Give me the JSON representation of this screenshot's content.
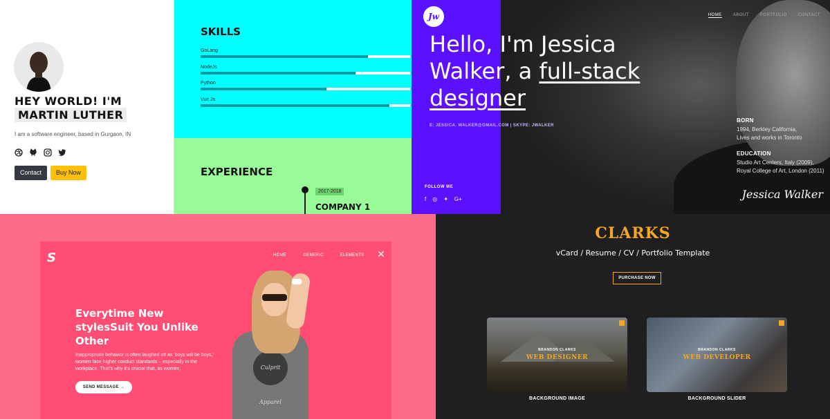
{
  "panel1": {
    "greeting": "HEY WORLD! I'M",
    "name": "MARTIN LUTHER",
    "bio": "I am a software engineer, based in Gurgaon, IN",
    "socials": [
      "dribbble-icon",
      "github-icon",
      "instagram-icon",
      "twitter-icon"
    ],
    "contact_label": "Contact",
    "buy_label": "Buy Now"
  },
  "panel2": {
    "skills_title": "SKILLS",
    "skills": [
      {
        "name": "GoLang",
        "level": 0.8
      },
      {
        "name": "NodeJs",
        "level": 0.74
      },
      {
        "name": "Python",
        "level": 0.6
      },
      {
        "name": "Vue Js",
        "level": 0.9
      }
    ],
    "experience_title": "EXPERIENCE",
    "years": "2017-2018",
    "company": "COMPANY 1"
  },
  "panel3": {
    "logo": "Jw",
    "nav": [
      "HOME",
      "ABOUT",
      "PORTFOLIO",
      "CONTACT"
    ],
    "headline_plain": "Hello, I'm Jessica Walker, a ",
    "headline_link": "full-stack designer",
    "email_line": "E: JESSICA. WALKER@GMAIL.COM | SKYPE: JWALKER",
    "follow": "FOLLOW ME",
    "follow_icons": [
      "f",
      "◎",
      "✦",
      "G+"
    ],
    "born_title": "BORN",
    "born_lines": [
      "1994, Berkley California,",
      "Lives and works in Toronto"
    ],
    "education_title": "EDUCATION",
    "education_lines": [
      "Studio Art Centers, Italy (2009),",
      "Royal College of Art, London (2011)"
    ],
    "signature": "Jessica Walker"
  },
  "panel4": {
    "nav": [
      "HOME",
      "GENERIC",
      "ELEMENTS"
    ],
    "title": "Everytime New stylesSuit You Unlike Other",
    "description": "Inappropriate behavior is often laughed off as 'boys will be boys,' women face higher conduct standards – especially in the workplace. That's why it's crucial that, as women,",
    "send_label": "SEND MESSAGE →",
    "shirt_text": "Culprit Apparel"
  },
  "panel5": {
    "brand": "CLARKS",
    "subtitle": "vCard / Resume / CV / Portfolio Template",
    "purchase": "PURCHASE NOW",
    "cards": [
      {
        "by": "BRANDON CLARKS",
        "role": "WEB DESIGNER",
        "caption": "BACKGROUND IMAGE"
      },
      {
        "by": "BRANDON CLARKS",
        "role": "WEB DEVELOPER",
        "caption": "BACKGROUND SLIDER"
      }
    ],
    "accent": "#f5a623"
  }
}
